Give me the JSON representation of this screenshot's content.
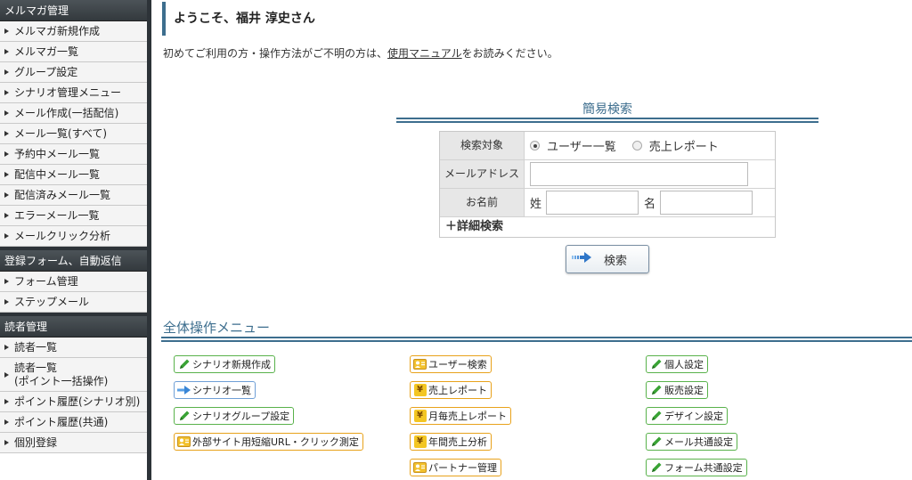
{
  "sidebar": {
    "sections": [
      {
        "title": "メルマガ管理",
        "items": [
          "メルマガ新規作成",
          "メルマガ一覧",
          "グループ設定",
          "シナリオ管理メニュー",
          "メール作成(一括配信)",
          "メール一覧(すべて)",
          "予約中メール一覧",
          "配信中メール一覧",
          "配信済みメール一覧",
          "エラーメール一覧",
          "メールクリック分析"
        ]
      },
      {
        "title": "登録フォーム、自動返信",
        "items": [
          "フォーム管理",
          "ステップメール"
        ]
      },
      {
        "title": "読者管理",
        "items": [
          "読者一覧",
          "読者一覧",
          "(ポイント一括操作)",
          "ポイント履歴(シナリオ別)",
          "ポイント履歴(共通)",
          "個別登録"
        ]
      }
    ]
  },
  "header": {
    "welcome": "ようこそ、福井 淳史さん",
    "intro_before": "初めてご利用の方・操作方法がご不明の方は、",
    "intro_link": "使用マニュアル",
    "intro_after": "をお読みください。"
  },
  "quick_search": {
    "title": "簡易検索",
    "target_label": "検索対象",
    "radio_options": [
      "ユーザー一覧",
      "売上レポート"
    ],
    "selected": "ユーザー一覧",
    "email_label": "メールアドレス",
    "email_value": "",
    "name_label": "お名前",
    "last_name_label": "姓",
    "first_name_label": "名",
    "last_name_value": "",
    "first_name_value": "",
    "advanced_label": "＋詳細検索",
    "search_button": "検索"
  },
  "menu": {
    "title": "全体操作メニュー",
    "col1": [
      {
        "label": "シナリオ新規作成",
        "icon": "pencil-icon",
        "color": "green"
      },
      {
        "label": "シナリオ一覧",
        "icon": "arrow-icon",
        "color": "blue"
      },
      {
        "label": "シナリオグループ設定",
        "icon": "pencil-icon",
        "color": "green"
      },
      {
        "label": "外部サイト用短縮URL・クリック測定",
        "icon": "person-card-icon",
        "color": "orange"
      }
    ],
    "col2": [
      {
        "label": "ユーザー検索",
        "icon": "person-card-icon",
        "color": "orange"
      },
      {
        "label": "売上レポート",
        "icon": "yen-icon",
        "color": "orange"
      },
      {
        "label": "月毎売上レポート",
        "icon": "yen-icon",
        "color": "orange"
      },
      {
        "label": "年間売上分析",
        "icon": "yen-icon",
        "color": "orange"
      },
      {
        "label": "パートナー管理",
        "icon": "person-card-icon",
        "color": "orange"
      }
    ],
    "col3": [
      {
        "label": "個人設定",
        "icon": "pencil-icon",
        "color": "green"
      },
      {
        "label": "販売設定",
        "icon": "pencil-icon",
        "color": "green"
      },
      {
        "label": "デザイン設定",
        "icon": "pencil-icon",
        "color": "green"
      },
      {
        "label": "メール共通設定",
        "icon": "pencil-icon",
        "color": "green"
      },
      {
        "label": "フォーム共通設定",
        "icon": "pencil-icon",
        "color": "green"
      }
    ]
  },
  "colors": {
    "accent": "#3d6e8e",
    "sidebar_dark": "#2d3338",
    "green": "#59b24b",
    "blue": "#6f9fd6",
    "orange": "#e8a21b"
  }
}
